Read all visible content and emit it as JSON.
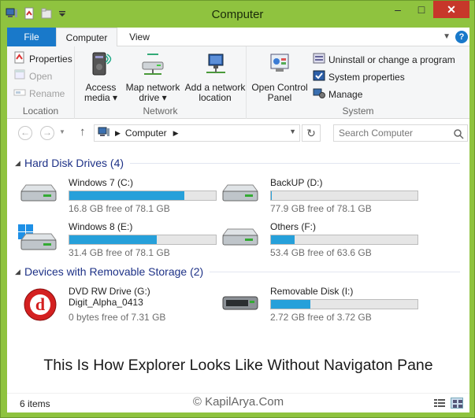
{
  "window": {
    "title": "Computer"
  },
  "quick_access": {
    "icons": [
      "computer-icon",
      "properties-icon",
      "new-folder-icon",
      "customize-dropdown"
    ]
  },
  "window_buttons": {
    "minimize": "–",
    "maximize": "□",
    "close": "✕"
  },
  "tabs": {
    "file": "File",
    "computer": "Computer",
    "view": "View",
    "help": "?"
  },
  "ribbon": {
    "location": {
      "label": "Location",
      "properties": "Properties",
      "open": "Open",
      "rename": "Rename"
    },
    "network": {
      "label": "Network",
      "access_media": [
        "Access",
        "media ▾"
      ],
      "map_network_drive": [
        "Map network",
        "drive ▾"
      ],
      "add_network_location": [
        "Add a network",
        "location"
      ]
    },
    "open_control_panel": [
      "Open Control",
      "Panel"
    ],
    "system": {
      "label": "System",
      "uninstall": "Uninstall or change a program",
      "system_properties": "System properties",
      "manage": "Manage"
    }
  },
  "navbar": {
    "back": "←",
    "forward": "→",
    "up": "↑",
    "breadcrumb": "Computer",
    "refresh": "↻",
    "search_placeholder": "Search Computer"
  },
  "sections": {
    "hard_disk": {
      "title": "Hard Disk Drives (4)"
    },
    "removable": {
      "title": "Devices with Removable Storage (2)"
    }
  },
  "drives": {
    "c": {
      "name": "Windows 7 (C:)",
      "free": "16.8 GB free of 78.1 GB",
      "used_fraction": 0.785
    },
    "d": {
      "name": "BackUP (D:)",
      "free": "77.9 GB free of 78.1 GB",
      "used_fraction": 0.003
    },
    "e": {
      "name": "Windows 8 (E:)",
      "free": "31.4 GB free of 78.1 GB",
      "used_fraction": 0.598
    },
    "f": {
      "name": "Others (F:)",
      "free": "53.4 GB free of 63.6 GB",
      "used_fraction": 0.16
    },
    "g": {
      "name": "DVD RW Drive (G:)",
      "label": "Digit_Alpha_0413",
      "free": "0 bytes free of 7.31 GB"
    },
    "i": {
      "name": "Removable Disk (I:)",
      "free": "2.72 GB free of 3.72 GB",
      "used_fraction": 0.269
    }
  },
  "caption": "This Is How Explorer Looks Like Without Navigaton Pane",
  "status": {
    "items": "6 items",
    "watermark": "© KapilArya.Com"
  },
  "colors": {
    "accent": "#1979ca",
    "bar_fill": "#26a0da",
    "frame": "#8fc33f",
    "section_title": "#1e3287"
  }
}
